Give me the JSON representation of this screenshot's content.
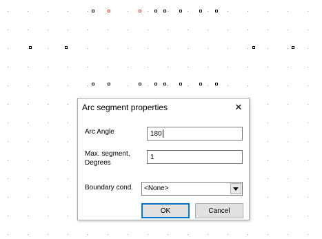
{
  "dialog": {
    "title": "Arc segment properties",
    "close_glyph": "✕",
    "arc_angle": {
      "label": "Arc Angle",
      "value": "180"
    },
    "max_segment": {
      "label_line1": "Max. segment,",
      "label_line2": "Degrees",
      "value": "1"
    },
    "boundary": {
      "label": "Boundary cond.",
      "selected": "<None>"
    },
    "ok_label": "OK",
    "cancel_label": "Cancel"
  },
  "colors": {
    "grid_dot": "#8a8aa8",
    "node": "#000000",
    "selected_node": "#e23b3b",
    "focus_border": "#0078d7"
  },
  "icons": {
    "close": "close-icon",
    "dropdown": "chevron-down-icon"
  }
}
